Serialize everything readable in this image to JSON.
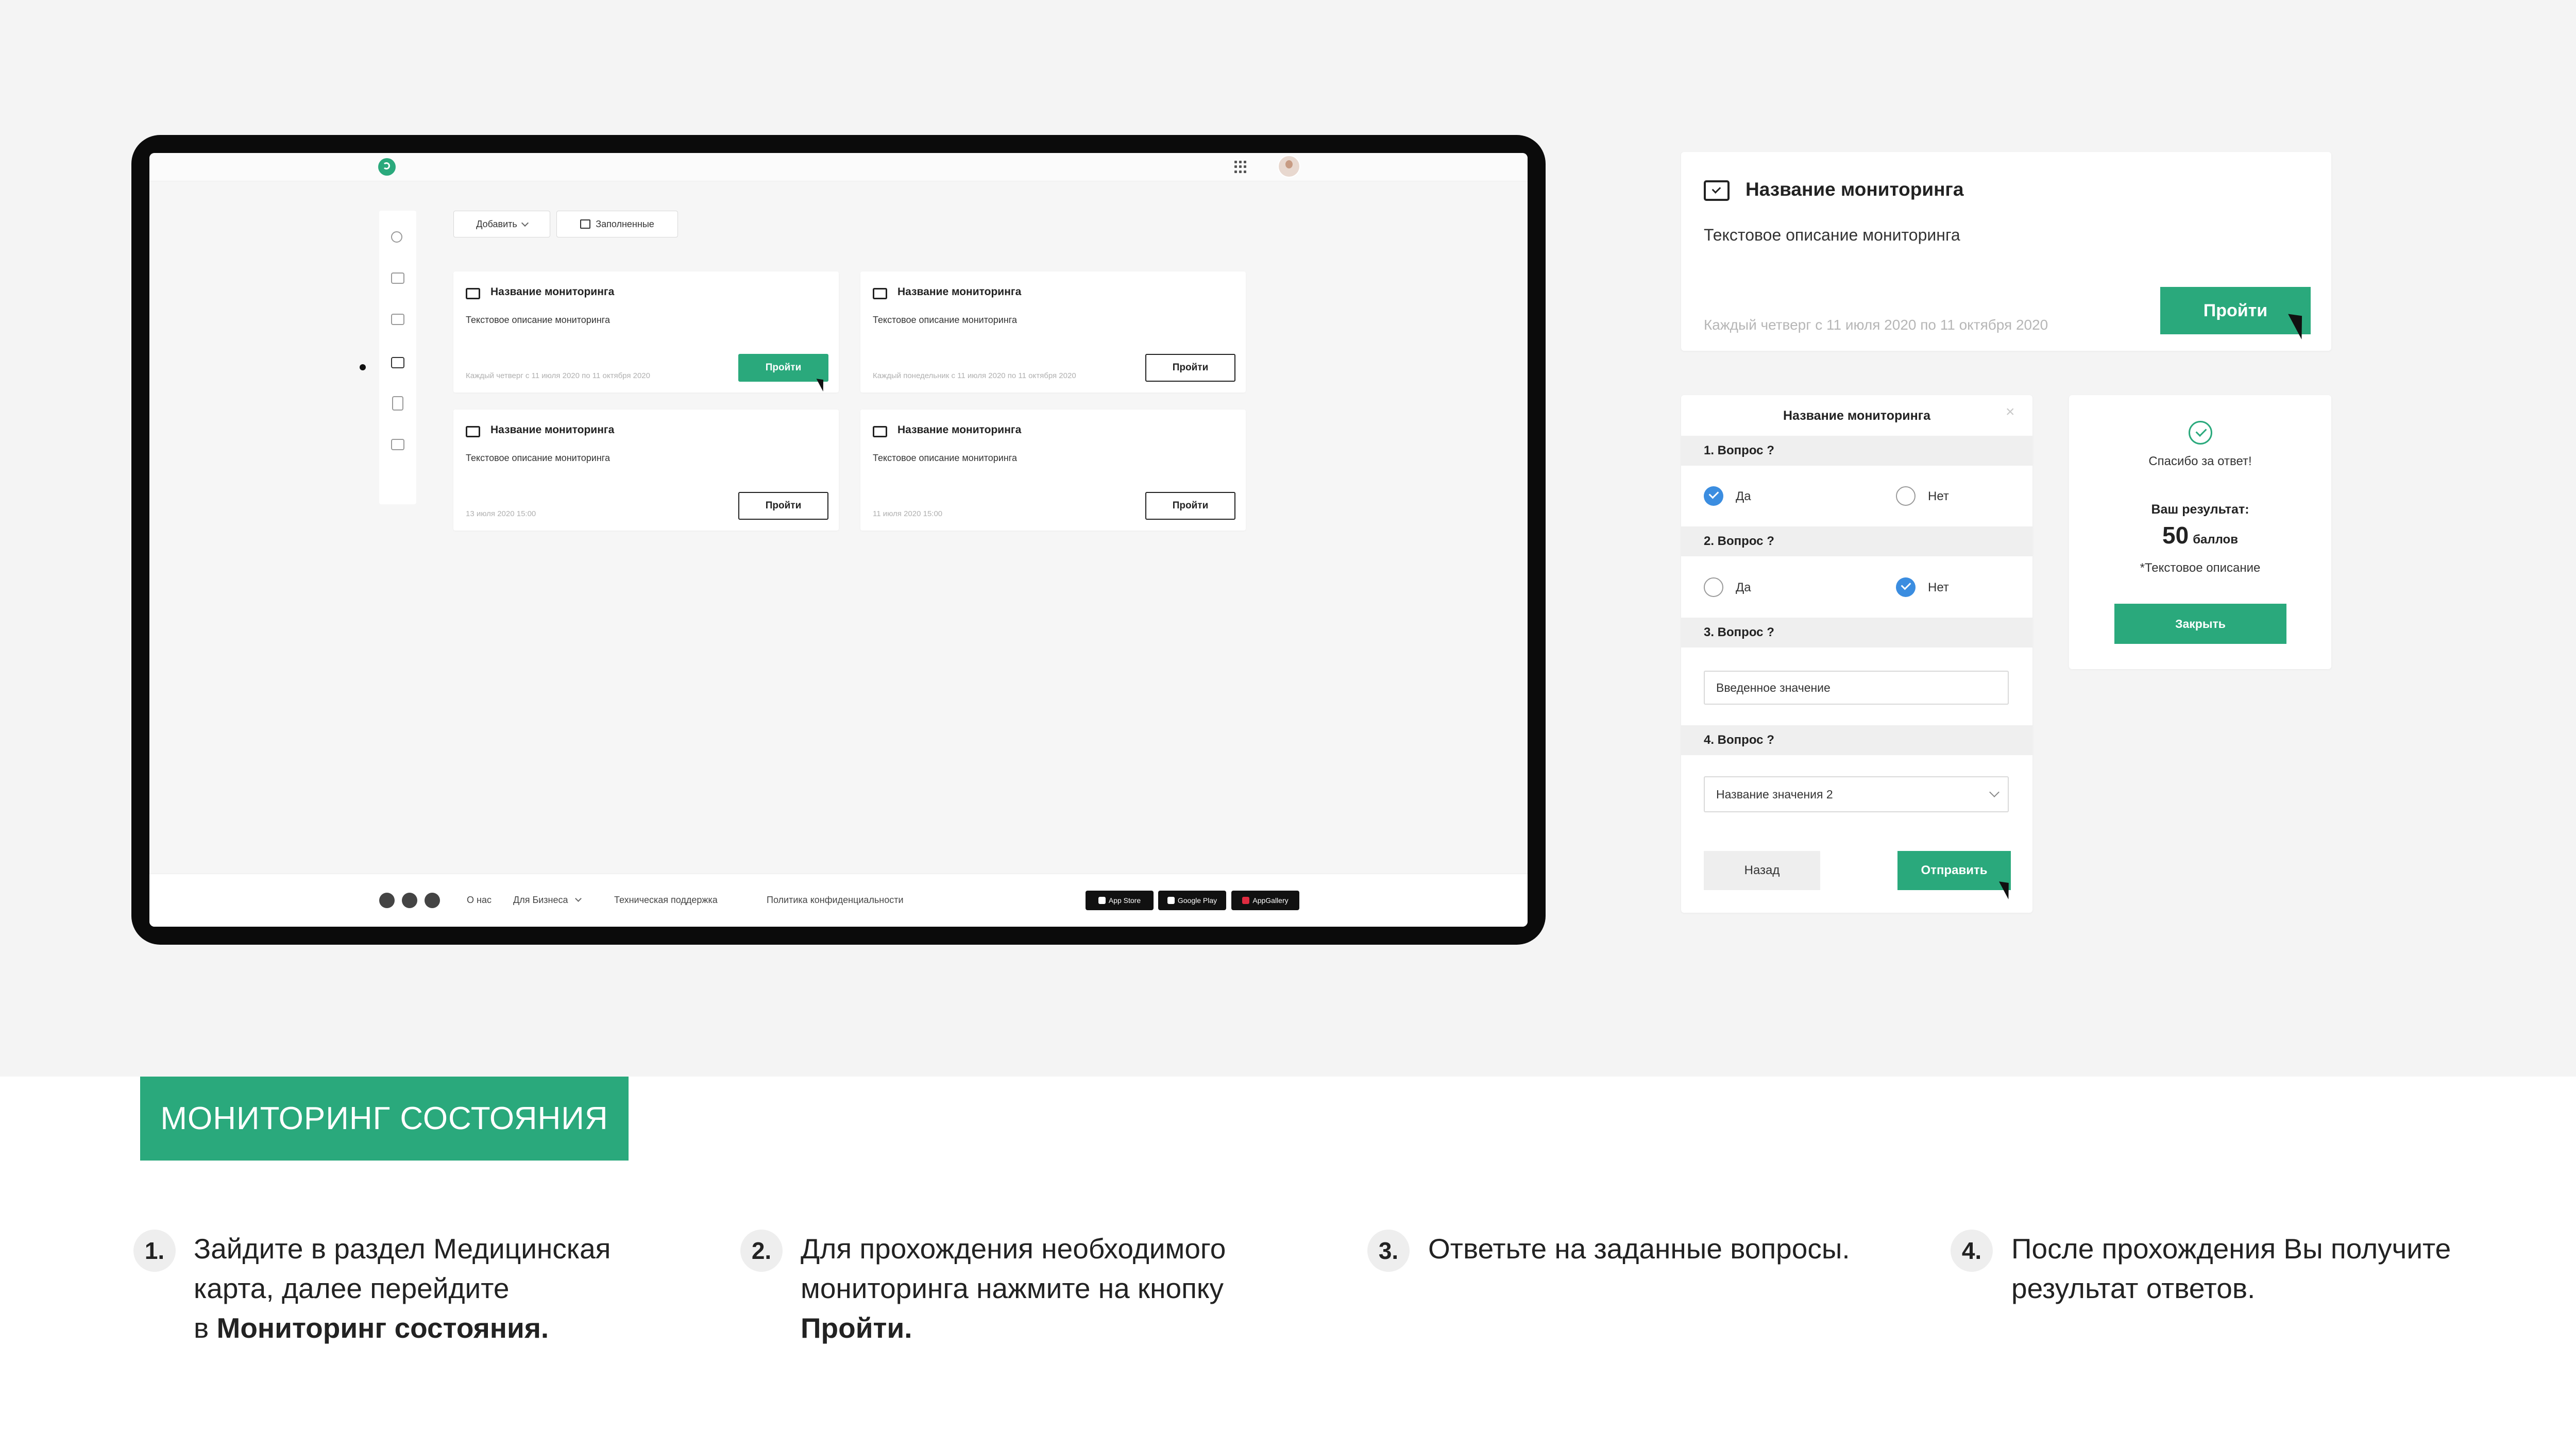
{
  "tablet": {
    "toolbar": {
      "add_label": "Добавить",
      "filled_label": "Заполненные"
    },
    "cards": [
      {
        "title": "Название мониторинга",
        "description": "Текстовое описание мониторинга",
        "date": "Каждый четверг с 11 июля 2020 по 11 октября 2020",
        "button": "Пройти"
      },
      {
        "title": "Название мониторинга",
        "description": "Текстовое описание мониторинга",
        "date": "Каждый понедельник с 11 июля 2020 по 11 октября 2020",
        "button": "Пройти"
      },
      {
        "title": "Название мониторинга",
        "description": "Текстовое описание мониторинга",
        "date": "13 июля 2020 15:00",
        "button": "Пройти"
      },
      {
        "title": "Название мониторинга",
        "description": "Текстовое описание мониторинга",
        "date": "11 июля 2020 15:00",
        "button": "Пройти"
      }
    ],
    "footer": {
      "links": [
        "О нас",
        "Для Бизнеса",
        "Техническая поддержка",
        "Политика конфиденциальности"
      ],
      "stores": [
        "App Store",
        "Google Play",
        "AppGallery"
      ]
    }
  },
  "monitoring_card": {
    "title": "Название мониторинга",
    "description": "Текстовое описание мониторинга",
    "date": "Каждый четверг с 11 июля 2020 по 11 октября 2020",
    "button": "Пройти"
  },
  "questionnaire": {
    "title": "Название мониторинга",
    "close": "×",
    "questions": [
      {
        "label": "1. Вопрос ?",
        "options": [
          "Да",
          "Нет"
        ],
        "selected": "Да"
      },
      {
        "label": "2. Вопрос ?",
        "options": [
          "Да",
          "Нет"
        ],
        "selected": "Нет"
      },
      {
        "label": "3. Вопрос ?",
        "input_value": "Введенное значение"
      },
      {
        "label": "4. Вопрос ?",
        "select_value": "Название значения 2"
      }
    ],
    "back_button": "Назад",
    "submit_button": "Отправить"
  },
  "result": {
    "thanks": "Спасибо за ответ!",
    "your_result": "Ваш результат:",
    "score": "50",
    "score_unit": "баллов",
    "note": "*Текстовое описание",
    "close_button": "Закрыть"
  },
  "section_title": "МОНИТОРИНГ СОСТОЯНИЯ",
  "steps": [
    {
      "num": "1.",
      "text_lines": [
        "Зайдите в раздел Медицинская",
        "карта, далее перейдите"
      ],
      "prefix": "в ",
      "bold": "Мониторинг состояния."
    },
    {
      "num": "2.",
      "text_lines": [
        "Для прохождения необходимого",
        "мониторинга нажмите на кнопку"
      ],
      "prefix": "",
      "bold": "Пройти."
    },
    {
      "num": "3.",
      "text_lines": [
        "Ответьте на заданные вопросы."
      ]
    },
    {
      "num": "4.",
      "text_lines": [
        "После прохождения Вы получите",
        "результат ответов."
      ]
    }
  ],
  "colors": {
    "accent": "#2aa97c",
    "radio": "#3b8de0",
    "background": "#f4f4f4"
  },
  "icons": [
    "logo-icon",
    "apps-grid-icon",
    "avatar",
    "monitor-check-icon",
    "facebook-icon",
    "instagram-icon",
    "telegram-icon",
    "cursor-icon",
    "check-circle-icon"
  ]
}
